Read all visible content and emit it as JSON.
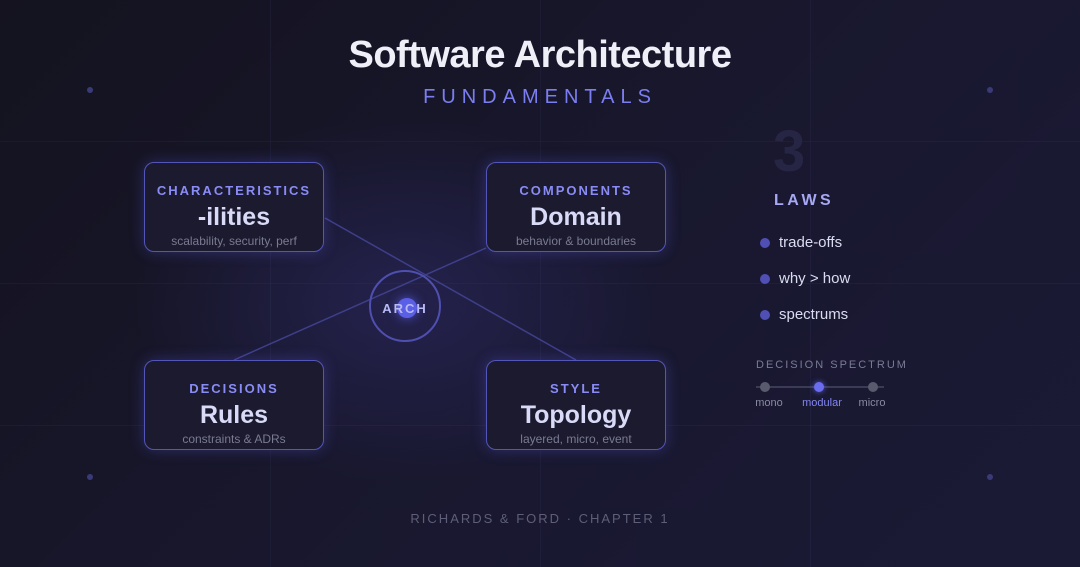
{
  "header": {
    "title": "Software Architecture",
    "subtitle": "FUNDAMENTALS"
  },
  "cards": [
    {
      "category": "CHARACTERISTICS",
      "name": "-ilities",
      "description": "scalability, security, perf"
    },
    {
      "category": "COMPONENTS",
      "name": "Domain",
      "description": "behavior & boundaries"
    },
    {
      "category": "DECISIONS",
      "name": "Rules",
      "description": "constraints & ADRs"
    },
    {
      "category": "STYLE",
      "name": "Topology",
      "description": "layered, micro, event"
    }
  ],
  "hub": {
    "label": "ARCH"
  },
  "laws": {
    "number": "3",
    "title": "LAWS",
    "items": [
      "trade-offs",
      "why > how",
      "spectrums"
    ]
  },
  "spectrum": {
    "title": "DECISION SPECTRUM",
    "options": [
      "mono",
      "modular",
      "micro"
    ],
    "selected": "modular"
  },
  "footer": {
    "text": "RICHARDS & FORD · CHAPTER 1"
  },
  "colors": {
    "background": "#13121f",
    "accent": "#7b7ef0",
    "card_border": "#5355b8"
  }
}
